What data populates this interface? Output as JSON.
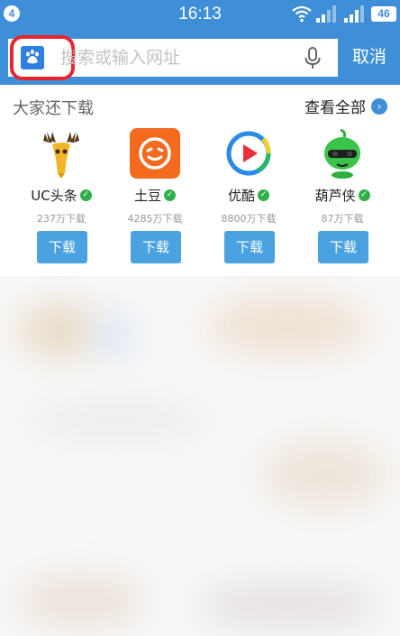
{
  "status_bar": {
    "notification_count": "4",
    "time": "16:13",
    "battery": "46"
  },
  "search": {
    "placeholder": "搜索或输入网址",
    "cancel_label": "取消"
  },
  "recommend": {
    "title": "大家还下载",
    "view_all": "查看全部",
    "apps": [
      {
        "name": "UC头条",
        "downloads": "237万下载",
        "button": "下载"
      },
      {
        "name": "土豆",
        "downloads": "4285万下载",
        "button": "下载"
      },
      {
        "name": "优酷",
        "downloads": "8800万下载",
        "button": "下载"
      },
      {
        "name": "葫芦侠",
        "downloads": "87万下载",
        "button": "下载"
      }
    ]
  },
  "colors": {
    "primary": "#3f8fd8",
    "download_button": "#4aa3e0",
    "verified": "#2fb04a",
    "highlight": "#e8242f"
  },
  "icons": [
    "wifi-icon",
    "signal-icon",
    "battery-icon",
    "baidu-paw-icon",
    "microphone-icon",
    "verified-check-icon",
    "chevron-right-icon"
  ]
}
